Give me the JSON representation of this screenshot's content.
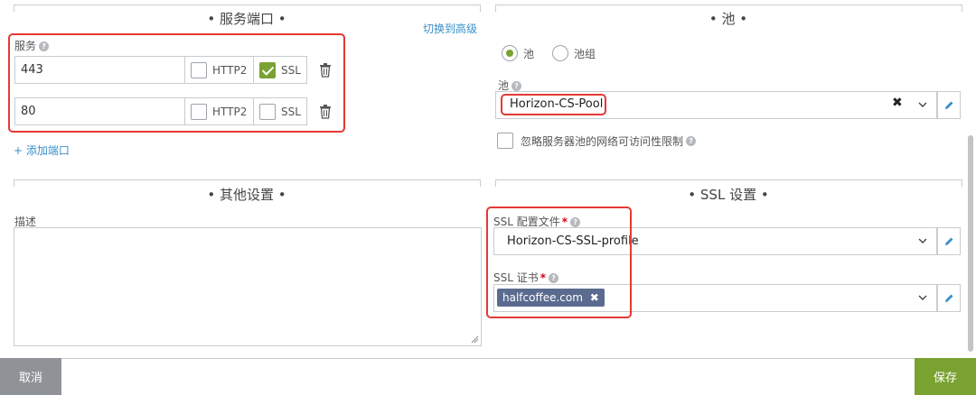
{
  "service_ports": {
    "title": "• 服务端口 •",
    "switch_advanced": "切换到高级",
    "label": "服务",
    "ports": [
      {
        "value": "443",
        "http2_label": "HTTP2",
        "http2": false,
        "ssl_label": "SSL",
        "ssl": true
      },
      {
        "value": "80",
        "http2_label": "HTTP2",
        "http2": false,
        "ssl_label": "SSL",
        "ssl": false
      }
    ],
    "add_port": "+ 添加端口"
  },
  "pool": {
    "title": "• 池 •",
    "radio_pool": "池",
    "radio_pool_group": "池组",
    "selected_radio": "pool",
    "label": "池",
    "value": "Horizon-CS-Pool",
    "ignore_label": "忽略服务器池的网络可访问性限制"
  },
  "other": {
    "title": "• 其他设置 •",
    "desc_label": "描述",
    "desc_value": ""
  },
  "ssl": {
    "title": "• SSL 设置 •",
    "profile_label": "SSL 配置文件",
    "profile_value": "Horizon-CS-SSL-profile",
    "cert_label": "SSL 证书",
    "cert_tag": "halfcoffee.com"
  },
  "footer": {
    "cancel": "取消",
    "save": "保存"
  },
  "colors": {
    "accent": "#7aa231",
    "annotation": "#e53935",
    "tag": "#5b6b8f",
    "link": "#3a8fc7"
  }
}
